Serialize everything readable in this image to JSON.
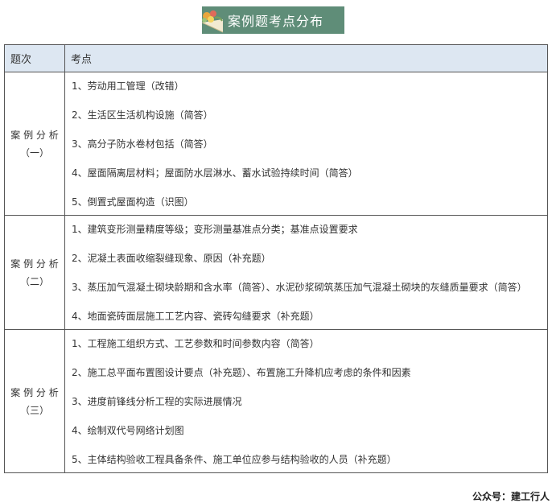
{
  "banner": {
    "title": "案例题考点分布",
    "icon": "flower-icon",
    "color": "#5f8d78"
  },
  "table": {
    "headers": [
      "题次",
      "考点"
    ],
    "sections": [
      {
        "title": "案 例 分 析",
        "number": "（一）",
        "items": [
          "1、劳动用工管理（改错）",
          "2、生活区生活机构设施（简答）",
          "3、高分子防水卷材包括（简答）",
          "4、屋面隔离层材料；屋面防水层淋水、蓄水试验持续时间（简答）",
          "5、倒置式屋面构造（识图）"
        ]
      },
      {
        "title": "案 例 分 析",
        "number": "（二）",
        "items": [
          "1、建筑变形测量精度等级；变形测量基准点分类；基准点设置要求",
          "2、泥凝土表面收缩裂缝现象、原因（补充题）",
          "3、蒸压加气混凝土砌块龄期和含水率（简答）、水泥砂浆砌筑蒸压加气混凝土砌块的灰缝质量要求（简答）",
          "4、地面瓷砖面层施工工艺内容、瓷砖勾缝要求（补充题）"
        ]
      },
      {
        "title": "案 例 分 析",
        "number": "（三）",
        "items": [
          "1、工程施工组织方式、工艺参数和时间参数内容（简答）",
          "2、施工总平面布置图设计要点（补充题）、布置施工升降机应考虑的条件和因素",
          "3、进度前锋线分析工程的实际进展情况",
          "4、绘制双代号网络计划图",
          "5、主体结构验收工程具备条件、施工单位应参与结构验收的人员（补充题）"
        ]
      }
    ]
  },
  "watermark": "公众号：建工行人"
}
